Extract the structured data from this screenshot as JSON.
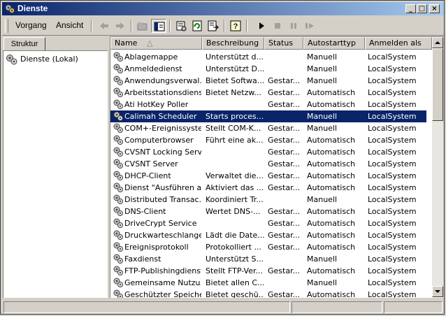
{
  "window": {
    "title": "Dienste"
  },
  "menu": {
    "items": [
      "Vorgang",
      "Ansicht"
    ]
  },
  "left_pane": {
    "tab_label": "Struktur",
    "tree_root": "Dienste (Lokal)"
  },
  "columns": [
    "Name",
    "Beschreibung",
    "Status",
    "Autostarttyp",
    "Anmelden als"
  ],
  "sort": {
    "column": "Name",
    "direction": "ascending"
  },
  "services": [
    {
      "name": "Ablagemappe",
      "desc": "Unterstützt d...",
      "status": "",
      "start": "Manuell",
      "logon": "LocalSystem"
    },
    {
      "name": "Anmeldedienst",
      "desc": "Unterstützt D...",
      "status": "",
      "start": "Manuell",
      "logon": "LocalSystem"
    },
    {
      "name": "Anwendungsverwal...",
      "desc": "Bietet Softwa...",
      "status": "Gestar...",
      "start": "Manuell",
      "logon": "LocalSystem"
    },
    {
      "name": "Arbeitsstationsdienst",
      "desc": "Bietet Netzw...",
      "status": "Gestar...",
      "start": "Automatisch",
      "logon": "LocalSystem"
    },
    {
      "name": "Ati HotKey Poller",
      "desc": "",
      "status": "Gestar...",
      "start": "Automatisch",
      "logon": "LocalSystem"
    },
    {
      "name": "Calimah Scheduler",
      "desc": "Starts proces...",
      "status": "",
      "start": "Manuell",
      "logon": "LocalSystem",
      "selected": true
    },
    {
      "name": "COM+-Ereignissystem",
      "desc": "Stellt COM-K...",
      "status": "Gestar...",
      "start": "Manuell",
      "logon": "LocalSystem"
    },
    {
      "name": "Computerbrowser",
      "desc": "Führt eine ak...",
      "status": "Gestar...",
      "start": "Automatisch",
      "logon": "LocalSystem"
    },
    {
      "name": "CVSNT Locking Service",
      "desc": "",
      "status": "Gestar...",
      "start": "Automatisch",
      "logon": "LocalSystem"
    },
    {
      "name": "CVSNT Server",
      "desc": "",
      "status": "Gestar...",
      "start": "Automatisch",
      "logon": "LocalSystem"
    },
    {
      "name": "DHCP-Client",
      "desc": "Verwaltet die...",
      "status": "Gestar...",
      "start": "Automatisch",
      "logon": "LocalSystem"
    },
    {
      "name": "Dienst \"Ausführen als\"",
      "desc": "Aktiviert das ...",
      "status": "Gestar...",
      "start": "Automatisch",
      "logon": "LocalSystem"
    },
    {
      "name": "Distributed Transac...",
      "desc": "Koordiniert Tr...",
      "status": "",
      "start": "Manuell",
      "logon": "LocalSystem"
    },
    {
      "name": "DNS-Client",
      "desc": "Wertet DNS-...",
      "status": "Gestar...",
      "start": "Automatisch",
      "logon": "LocalSystem"
    },
    {
      "name": "DriveCrypt Service",
      "desc": "",
      "status": "Gestar...",
      "start": "Automatisch",
      "logon": "LocalSystem"
    },
    {
      "name": "Druckwarteschlange",
      "desc": "Lädt die Date...",
      "status": "Gestar...",
      "start": "Automatisch",
      "logon": "LocalSystem"
    },
    {
      "name": "Ereignisprotokoll",
      "desc": "Protokolliert ...",
      "status": "Gestar...",
      "start": "Automatisch",
      "logon": "LocalSystem"
    },
    {
      "name": "Faxdienst",
      "desc": "Unterstützt S...",
      "status": "",
      "start": "Manuell",
      "logon": "LocalSystem"
    },
    {
      "name": "FTP-Publishingdienst",
      "desc": "Stellt FTP-Ver...",
      "status": "Gestar...",
      "start": "Automatisch",
      "logon": "LocalSystem"
    },
    {
      "name": "Gemeinsame Nutzu...",
      "desc": "Bietet allen C...",
      "status": "",
      "start": "Manuell",
      "logon": "LocalSystem"
    },
    {
      "name": "Geschützter Speicher",
      "desc": "Bietet geschü...",
      "status": "Gestar...",
      "start": "Automatisch",
      "logon": "LocalSystem"
    }
  ],
  "toolbar": {
    "icons": [
      "back-arrow-icon",
      "forward-arrow-icon",
      "up-folder-icon",
      "show-hide-tree-icon",
      "properties-icon",
      "refresh-icon",
      "export-list-icon",
      "help-icon",
      "start-service-icon",
      "stop-service-icon",
      "pause-service-icon",
      "restart-service-icon"
    ]
  }
}
